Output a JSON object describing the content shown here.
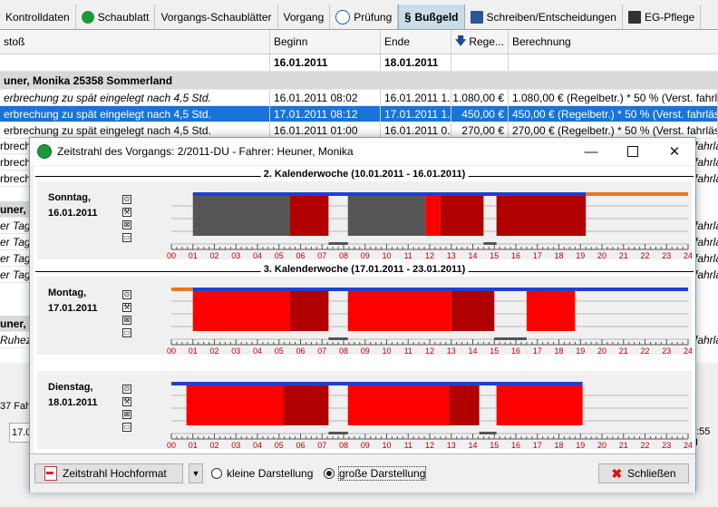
{
  "tabs": [
    {
      "label": "Kontrolldaten",
      "icon": "none"
    },
    {
      "label": "Schaublatt",
      "icon": "green-disc-icon"
    },
    {
      "label": "Vorgangs-Schaublätter",
      "icon": "none"
    },
    {
      "label": "Vorgang",
      "icon": "none"
    },
    {
      "label": "Prüfung",
      "icon": "stopwatch-icon"
    },
    {
      "label": "Bußgeld",
      "icon": "paragraph-icon",
      "prefix": "§"
    },
    {
      "label": "Schreiben/Entscheidungen",
      "icon": "word-doc-icon"
    },
    {
      "label": "EG-Pflege",
      "icon": "book-icon"
    }
  ],
  "grid": {
    "columns": [
      "stoß",
      "Beginn",
      "Ende",
      "Rege...",
      "Berechnung"
    ],
    "filter_row": {
      "begin": "16.01.2011",
      "end": "18.01.2011"
    },
    "group_header": "uner, Monika 25358 Sommerland",
    "rows": [
      {
        "text": "erbrechung zu spät eingelegt nach 4,5 Std.",
        "begin": "16.01.2011 08:02",
        "end": "16.01.2011 1...",
        "amount": "1.080,00 €",
        "calc": "1.080,00 € (Regelbetr.)  * 50 % (Verst. fahrlässig)",
        "italic": true,
        "selected": false
      },
      {
        "text": "erbrechung zu spät eingelegt nach 4,5 Std.",
        "begin": "17.01.2011 08:12",
        "end": "17.01.2011 1...",
        "amount": "450,00 €",
        "calc": "450,00 € (Regelbetr.)  * 50 % (Verst. fahrlässig)",
        "italic": false,
        "selected": true
      },
      {
        "text": "erbrechung zu spät eingelegt nach 4,5 Std.",
        "begin": "16.01.2011 01:00",
        "end": "16.01.2011 0...",
        "amount": "270,00 €",
        "calc": "270,00 € (Regelbetr.)  * 50 % (Verst. fahrlässig)",
        "italic": false,
        "selected": false
      }
    ],
    "side_fragments": [
      "rbrech",
      "rbrech",
      "rbrech",
      "uner,",
      "er Tag",
      "er Tag",
      "er Tag",
      "er Tag",
      "uner,",
      "Ruheze"
    ],
    "right_fragments": [
      "fahrlässi",
      "fahrlässi",
      "fahrlässi",
      "fahrlässi",
      "fahrlässi",
      "fahrlässi",
      "fahrlässi",
      "fahrlässi"
    ]
  },
  "bottom": {
    "count_text": "37 Fah",
    "field_value": "17.0",
    "time_text": "2:55 H"
  },
  "dialog": {
    "title": "Zeitstrahl des Vorgangs: 2/2011-DU - Fahrer: Heuner, Monika",
    "weeks": [
      {
        "label": "2. Kalenderwoche (10.01.2011 - 16.01.2011)"
      },
      {
        "label": "3. Kalenderwoche (17.01.2011 - 23.01.2011)"
      }
    ],
    "days": [
      {
        "weekday": "Sonntag,",
        "date": "16.01.2011",
        "top_line": [
          {
            "from": 1.0,
            "to": 19.25,
            "color": "#1f3fd6"
          },
          {
            "from": 19.25,
            "to": 24,
            "color": "#e87722"
          }
        ],
        "blocks": [
          {
            "from": 1.0,
            "to": 5.5,
            "row": 1,
            "color": "#555555"
          },
          {
            "from": 5.5,
            "to": 7.3,
            "row": 1,
            "color": "#b00000"
          },
          {
            "from": 7.3,
            "to": 8.2,
            "row": 3,
            "color": "#555555"
          },
          {
            "from": 8.2,
            "to": 11.8,
            "row": 1,
            "color": "#555555"
          },
          {
            "from": 11.8,
            "to": 12.5,
            "row": 1,
            "color": "#ff0000"
          },
          {
            "from": 12.5,
            "to": 14.5,
            "row": 1,
            "color": "#b00000"
          },
          {
            "from": 14.5,
            "to": 15.1,
            "row": 3,
            "color": "#555555"
          },
          {
            "from": 15.1,
            "to": 19.25,
            "row": 1,
            "color": "#b00000"
          }
        ]
      },
      {
        "weekday": "Montag,",
        "date": "17.01.2011",
        "top_line": [
          {
            "from": 0,
            "to": 1.0,
            "color": "#e87722"
          },
          {
            "from": 1.0,
            "to": 24,
            "color": "#1f3fd6"
          }
        ],
        "blocks": [
          {
            "from": 1.0,
            "to": 5.5,
            "row": 1,
            "color": "#ff0000"
          },
          {
            "from": 5.5,
            "to": 7.3,
            "row": 1,
            "color": "#b00000"
          },
          {
            "from": 7.3,
            "to": 8.2,
            "row": 3,
            "color": "#555555"
          },
          {
            "from": 8.2,
            "to": 13.0,
            "row": 1,
            "color": "#ff0000"
          },
          {
            "from": 13.0,
            "to": 15.0,
            "row": 1,
            "color": "#b00000"
          },
          {
            "from": 15.0,
            "to": 16.5,
            "row": 3,
            "color": "#555555"
          },
          {
            "from": 16.5,
            "to": 18.75,
            "row": 1,
            "color": "#ff0000"
          }
        ]
      },
      {
        "weekday": "Dienstag,",
        "date": "18.01.2011",
        "top_line": [
          {
            "from": 0,
            "to": 19.1,
            "color": "#1f3fd6"
          }
        ],
        "blocks": [
          {
            "from": 0.7,
            "to": 5.2,
            "row": 1,
            "color": "#ff0000"
          },
          {
            "from": 5.2,
            "to": 7.3,
            "row": 1,
            "color": "#b00000"
          },
          {
            "from": 7.3,
            "to": 8.2,
            "row": 3,
            "color": "#555555"
          },
          {
            "from": 8.2,
            "to": 12.9,
            "row": 1,
            "color": "#ff0000"
          },
          {
            "from": 12.9,
            "to": 14.3,
            "row": 1,
            "color": "#b00000"
          },
          {
            "from": 14.3,
            "to": 15.1,
            "row": 3,
            "color": "#555555"
          },
          {
            "from": 15.1,
            "to": 19.1,
            "row": 1,
            "color": "#ff0000"
          }
        ]
      }
    ],
    "hour_labels": [
      "00",
      "01",
      "02",
      "03",
      "04",
      "05",
      "06",
      "07",
      "08",
      "09",
      "10",
      "11",
      "12",
      "13",
      "14",
      "15",
      "16",
      "17",
      "18",
      "19",
      "20",
      "21",
      "22",
      "23",
      "24"
    ],
    "buttons": {
      "timeline_format": "Zeitstrahl Hochformat",
      "close": "Schließen"
    },
    "radios": [
      {
        "label": "kleine Darstellung",
        "checked": false
      },
      {
        "label": "große Darstellung",
        "checked": true
      }
    ]
  }
}
